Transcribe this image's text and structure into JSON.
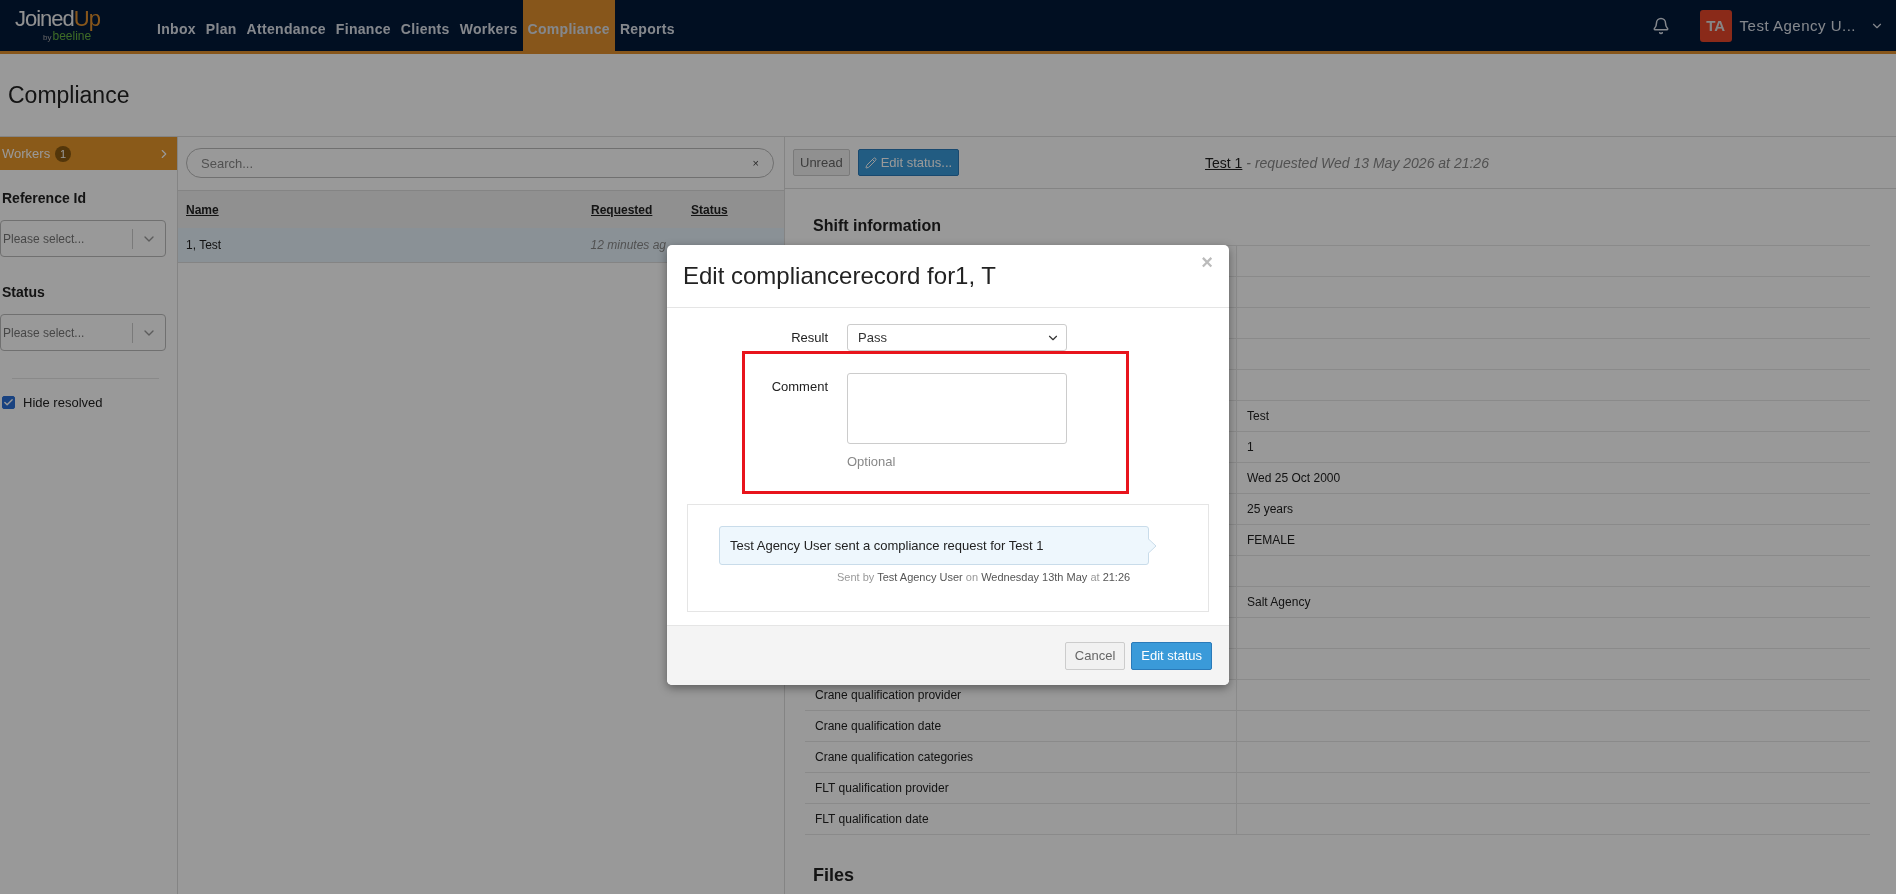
{
  "nav": {
    "logo_main": "Joined",
    "logo_accent": "Up",
    "logo_by": "by",
    "logo_sub": "beeline",
    "items": [
      {
        "label": "Inbox",
        "selected": false
      },
      {
        "label": "Plan",
        "selected": false
      },
      {
        "label": "Attendance",
        "selected": false
      },
      {
        "label": "Finance",
        "selected": false
      },
      {
        "label": "Clients",
        "selected": false
      },
      {
        "label": "Workers",
        "selected": false
      },
      {
        "label": "Compliance",
        "selected": true
      },
      {
        "label": "Reports",
        "selected": false
      }
    ],
    "user": {
      "initials": "TA",
      "name": "Test Agency U..."
    }
  },
  "page_title": "Compliance",
  "sidebar": {
    "section": {
      "label": "Workers",
      "count": "1"
    },
    "filters": [
      {
        "label": "Reference Id",
        "placeholder": "Please select..."
      },
      {
        "label": "Status",
        "placeholder": "Please select..."
      }
    ],
    "hide_resolved": {
      "label": "Hide resolved",
      "checked": true
    }
  },
  "list": {
    "search_placeholder": "Search...",
    "clear": "×",
    "columns": [
      "Name",
      "Requested",
      "Status"
    ],
    "rows": [
      {
        "name": "1, Test",
        "requested": "12 minutes ag",
        "selected": true
      }
    ]
  },
  "detail": {
    "unread_button": "Unread",
    "edit_button": "Edit status...",
    "record_link": "Test 1",
    "requested_text": "- requested Wed 13 May 2026 at 21:26",
    "section": "Shift information",
    "rows": [
      {},
      {},
      {},
      {},
      {},
      {
        "value": "Test"
      },
      {
        "value": "1"
      },
      {
        "value": "Wed 25 Oct 2000"
      },
      {
        "value": "25 years"
      },
      {
        "value": "FEMALE"
      },
      {},
      {
        "value": "Salt Agency"
      },
      {},
      {},
      {
        "label": "Crane qualification provider"
      },
      {
        "label": "Crane qualification date"
      },
      {
        "label": "Crane qualification categories"
      },
      {
        "label": "FLT qualification provider"
      },
      {
        "label": "FLT qualification date"
      }
    ],
    "files_heading": "Files"
  },
  "modal": {
    "title": "Edit compliancerecord for1, T",
    "close": "×",
    "result_label": "Result",
    "result_value": "Pass",
    "comment_label": "Comment",
    "comment_hint": "Optional",
    "message": "Test Agency User sent a compliance request for Test 1",
    "meta": "Sent by **Test Agency User** on **Wednesday 13th May** at **21:26**",
    "buttons": [
      {
        "label": "Cancel",
        "kind": "secondary"
      },
      {
        "label": "Edit status",
        "kind": "primary"
      }
    ]
  }
}
